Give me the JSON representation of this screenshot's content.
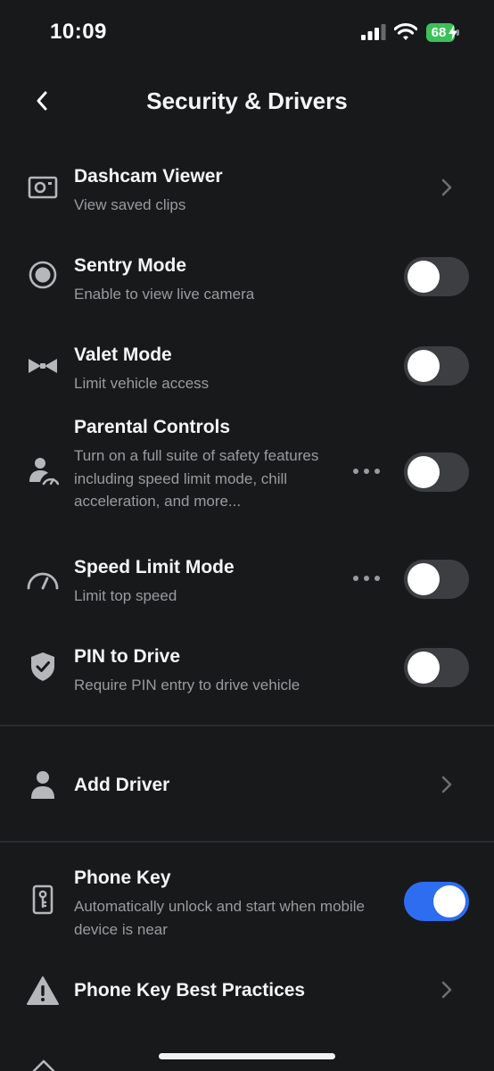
{
  "status_bar": {
    "time": "10:09",
    "battery": "68"
  },
  "header": {
    "title": "Security & Drivers"
  },
  "rows": {
    "dashcam": {
      "title": "Dashcam Viewer",
      "subtitle": "View saved clips",
      "icon": "camera-icon"
    },
    "sentry": {
      "title": "Sentry Mode",
      "subtitle": "Enable to view live camera",
      "icon": "sentry-icon",
      "enabled": false
    },
    "valet": {
      "title": "Valet Mode",
      "subtitle": "Limit vehicle access",
      "icon": "bowtie-icon",
      "enabled": false
    },
    "parental": {
      "title": "Parental Controls",
      "subtitle": "Turn on a full suite of safety features including speed limit mode, chill acceleration, and more...",
      "icon": "parental-icon",
      "enabled": false
    },
    "speed_limit": {
      "title": "Speed Limit Mode",
      "subtitle": "Limit top speed",
      "icon": "speedometer-icon",
      "enabled": false
    },
    "pin": {
      "title": "PIN to Drive",
      "subtitle": "Require PIN entry to drive vehicle",
      "icon": "shield-check-icon",
      "enabled": false
    },
    "add_driver": {
      "title": "Add Driver",
      "icon": "person-icon"
    },
    "phone_key": {
      "title": "Phone Key",
      "subtitle": "Automatically unlock and start when mobile device is near",
      "icon": "phone-key-icon",
      "enabled": true
    },
    "best_practices": {
      "title": "Phone Key Best Practices",
      "icon": "warning-icon"
    }
  },
  "colors": {
    "background": "#18191b",
    "toggle_on": "#2f6df0",
    "toggle_off": "#3d3e42",
    "battery": "#3cc15a",
    "subtext": "#9a9b9e"
  }
}
